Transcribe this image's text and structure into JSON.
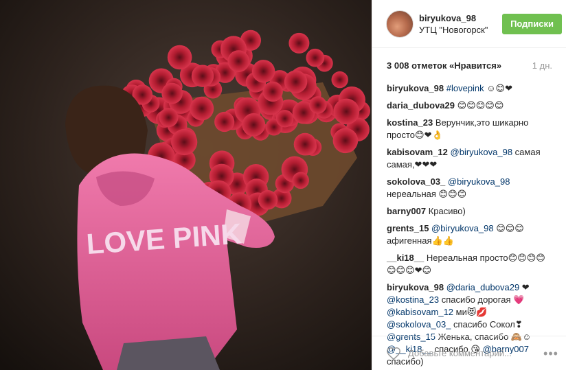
{
  "post": {
    "username": "biryukova_98",
    "location": "УТЦ \"Новогорск\"",
    "follow_label": "Подписки",
    "likes_text": "3 008 отметок «Нравится»",
    "time_text": "1 дн.",
    "photo_text": "LOVE PINK"
  },
  "comments": [
    {
      "author": "biryukova_98",
      "parts": [
        {
          "t": "tag",
          "v": "#lovepink"
        },
        {
          "t": "text",
          "v": " ☺😊❤"
        }
      ]
    },
    {
      "author": "daria_dubova29",
      "parts": [
        {
          "t": "text",
          "v": "😊😊😊😊😊"
        }
      ]
    },
    {
      "author": "kostina_23",
      "parts": [
        {
          "t": "text",
          "v": "Верунчик,это шикарно просто😊❤👌"
        }
      ]
    },
    {
      "author": "kabisovam_12",
      "parts": [
        {
          "t": "mention",
          "v": "@biryukova_98"
        },
        {
          "t": "text",
          "v": " самая самая,❤❤❤"
        }
      ]
    },
    {
      "author": "sokolova_03_",
      "parts": [
        {
          "t": "mention",
          "v": "@biryukova_98"
        },
        {
          "t": "text",
          "v": " нереальная 😊😊😊"
        }
      ]
    },
    {
      "author": "barny007",
      "parts": [
        {
          "t": "text",
          "v": "Красиво)"
        }
      ]
    },
    {
      "author": "grents_15",
      "parts": [
        {
          "t": "mention",
          "v": "@biryukova_98"
        },
        {
          "t": "text",
          "v": " 😊😊😊 афигенная👍👍"
        }
      ]
    },
    {
      "author": "__ki18__",
      "parts": [
        {
          "t": "text",
          "v": "Нереальная просто😊😊😊😊😊😊😊❤😊"
        }
      ]
    },
    {
      "author": "biryukova_98",
      "parts": [
        {
          "t": "mention",
          "v": "@daria_dubova29"
        },
        {
          "t": "text",
          "v": " ❤ "
        },
        {
          "t": "mention",
          "v": "@kostina_23"
        },
        {
          "t": "text",
          "v": " спасибо дорогая 💗 "
        },
        {
          "t": "mention",
          "v": "@kabisovam_12"
        },
        {
          "t": "text",
          "v": " ми😻💋 "
        },
        {
          "t": "mention",
          "v": "@sokolova_03_"
        },
        {
          "t": "text",
          "v": " спасибо Сокол❣ "
        },
        {
          "t": "mention",
          "v": "@grents_15"
        },
        {
          "t": "text",
          "v": " Женька, спасибо 🙈☺ "
        },
        {
          "t": "mention",
          "v": "@__ki18__"
        },
        {
          "t": "text",
          "v": " спасибо 😘 "
        },
        {
          "t": "mention",
          "v": "@barny007"
        },
        {
          "t": "text",
          "v": " спасибо)"
        }
      ]
    }
  ],
  "footer": {
    "placeholder": "Добавьте комментарий...",
    "more_label": "•••"
  },
  "icons": {
    "like": "heart-outline-icon",
    "more": "ellipsis-icon"
  },
  "colors": {
    "follow": "#70c050",
    "mention": "#003569",
    "hoodie": "#e0679a",
    "roses": "#c8253a"
  }
}
